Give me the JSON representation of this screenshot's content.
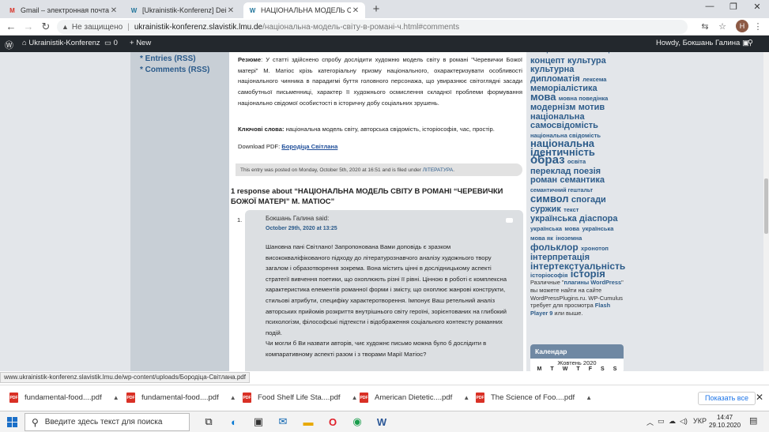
{
  "tabs": [
    {
      "title": "Gmail – электронная почта от G",
      "favicon": "M",
      "active": false
    },
    {
      "title": "[Ukrainistik-Konferenz] Dein Ben",
      "favicon": "W",
      "active": false
    },
    {
      "title": "НАЦІОНАЛЬНА МОДЕЛЬ СВІТУ",
      "favicon": "W",
      "active": true
    }
  ],
  "address": {
    "security": "Не защищено",
    "host": "ukrainistik-konferenz.slavistik.lmu.de",
    "path": "/національна-модель-світу-в-романі-ч.html#comments"
  },
  "profile_initial": "H",
  "wpbar": {
    "site": "Ukrainistik-Konferenz",
    "comments": "0",
    "new": "New",
    "howdy": "Howdy, Бокшань Галина"
  },
  "left_sidebar": {
    "entries": "Entries (RSS)",
    "comments": "Comments (RSS)"
  },
  "post": {
    "abstract_label": "Резюме",
    "abstract_text": ": У статті здійснено спробу дослідити художню модель світу в романі \"Черевички Божої матері\" М. Матіос крізь категоріальну призму національного, охарактеризувати особливості національного чинника в парадигмі буття головного персонажа, що увиразнює світоглядні засади самобутньої письменниці, характер її художнього осмислення складної проблеми формування національно свідомої особистості в історичну добу соціальних зрушень.",
    "keywords_label": "Ключові слова:",
    "keywords_text": " національна модель світу, авторська свідомість, історіософія, час, простір.",
    "download_label": "Download PDF: ",
    "download_link": "Бородіца Світлана",
    "meta_text": "This entry was posted on Monday, October 5th, 2020 at 16:51 and is filed under ",
    "meta_category": "ЛІТЕРАТУРА",
    "meta_end": "."
  },
  "responses_heading": "1 response about “НАЦІОНАЛЬНА МОДЕЛЬ СВІТУ В РОМАНІ “ЧЕРЕВИЧКИ БОЖОЇ МАТЕРІ” М. МАТІОС”",
  "comment": {
    "number": "1.",
    "author": "Бокшань Галина said:",
    "date": "October 29th, 2020 at 13:25",
    "text": "Шановна пані Світлано! Запропонована Вами доповідь є зразком висококваліфікованого підходу до літературознавчого аналізу художнього твору загалом і образотворення зокрема. Вона містить цінні в дослідницькому аспекті стратегії вивчення поетики, що охоплюють різні її рівні. Цінною в роботі є комплексна характеристика елементів романної форми і змісту, що охоплює жанрові конструкти, стильові атрибути, специфіку характеротворення. Імпонує Ваш ретельний аналіз авторських прийомів розкриття внутрішнього світу героїні, зорієнтованих на глибокий психологізм, філософські підтексти і відображення соціального контексту романних подій.",
    "question": "Чи могли б Ви назвати авторів, чиє художнє письмо можна було б дослідити в компаративному аспекті разом і з творами Марії Матіос?"
  },
  "tag_cloud": [
    {
      "t": "козацтво",
      "s": 8
    },
    {
      "t": "контент",
      "s": 11
    },
    {
      "t": "конфлікт",
      "s": 7
    },
    {
      "t": "концепт",
      "s": 11
    },
    {
      "t": "культура",
      "s": 11
    },
    {
      "t": "культурна",
      "s": 11
    },
    {
      "t": "дипломатія",
      "s": 11
    },
    {
      "t": "лексема",
      "s": 7.5
    },
    {
      "t": "меморіалістика",
      "s": 11
    },
    {
      "t": "мова",
      "s": 13
    },
    {
      "t": "мовна поведінка",
      "s": 7.5
    },
    {
      "t": "модернізм",
      "s": 11
    },
    {
      "t": "мотив",
      "s": 11
    },
    {
      "t": "національна",
      "s": 11
    },
    {
      "t": "самосвідомість",
      "s": 11
    },
    {
      "t": "національна свідомість",
      "s": 7.5
    },
    {
      "t": "національна",
      "s": 13
    },
    {
      "t": "ідентичність",
      "s": 13
    },
    {
      "t": "образ",
      "s": 15
    },
    {
      "t": "освіта",
      "s": 7.5
    },
    {
      "t": "переклад",
      "s": 11
    },
    {
      "t": "поезія",
      "s": 11
    },
    {
      "t": "роман",
      "s": 11
    },
    {
      "t": "семантика",
      "s": 11
    },
    {
      "t": "семантичний гештальт",
      "s": 7
    },
    {
      "t": "символ",
      "s": 13
    },
    {
      "t": "спогади",
      "s": 11
    },
    {
      "t": "суржик",
      "s": 11
    },
    {
      "t": "текст",
      "s": 7.5
    },
    {
      "t": "українська",
      "s": 11
    },
    {
      "t": "діаспора",
      "s": 11
    },
    {
      "t": "українська",
      "s": 7.5
    },
    {
      "t": "мова",
      "s": 7.5
    },
    {
      "t": "українська мова як",
      "s": 7.5
    },
    {
      "t": "іноземна",
      "s": 7.5
    },
    {
      "t": "фольклор",
      "s": 12
    },
    {
      "t": "хронотоп",
      "s": 7.5
    },
    {
      "t": "інтерпретація",
      "s": 11
    },
    {
      "t": "інтертекстуальність",
      "s": 12
    },
    {
      "t": "історіософія",
      "s": 7.5
    },
    {
      "t": "історія",
      "s": 13
    }
  ],
  "plugin_note": {
    "t1": "Различные \"",
    "l1": "плагины WordPress",
    "t2": "\" вы можете найти на сайте WordPressPlugins.ru. WP-Cumulus требует для просмотра ",
    "l2": "Flash Player 9",
    "t3": " или выше."
  },
  "calendar": {
    "title": "Календар",
    "month": "Жовтень 2020",
    "days": [
      "M",
      "T",
      "W",
      "T",
      "F",
      "S",
      "S"
    ]
  },
  "status_url": "www.ukrainistik-konferenz.slavistik.lmu.de/wp-content/uploads/Бородіца-Світлана.pdf",
  "downloads": [
    {
      "name": "fundamental-food....pdf"
    },
    {
      "name": "fundamental-food....pdf"
    },
    {
      "name": "Food Shelf Life Sta....pdf"
    },
    {
      "name": "American Dietetic....pdf"
    },
    {
      "name": "The Science of Foo....pdf"
    }
  ],
  "show_all": "Показать все",
  "taskbar": {
    "search_placeholder": "Введите здесь текст для поиска",
    "lang": "УКР",
    "time": "14:47",
    "date": "29.10.2020"
  }
}
